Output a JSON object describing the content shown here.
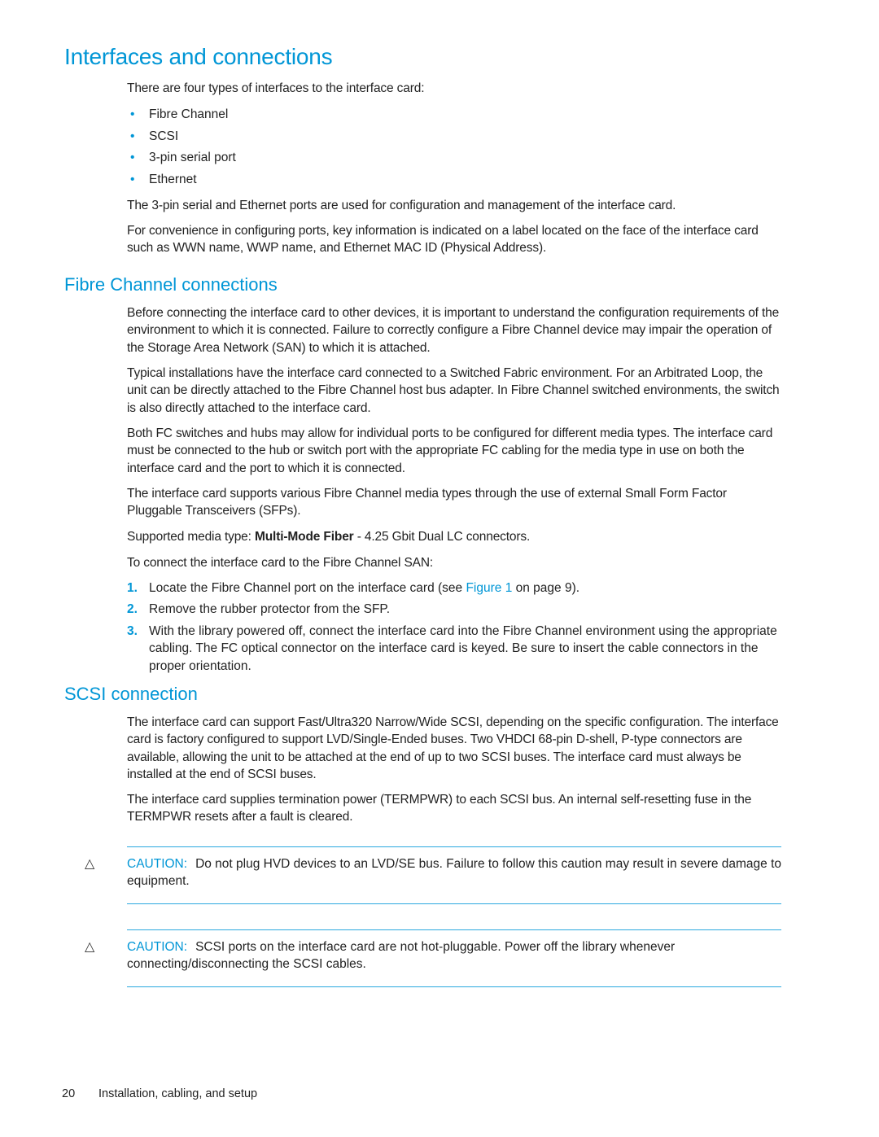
{
  "title": "Interfaces and connections",
  "intro": "There are four types of interfaces to the interface card:",
  "interface_types": [
    "Fibre Channel",
    "SCSI",
    "3-pin serial port",
    "Ethernet"
  ],
  "para_serial": "The 3-pin serial and Ethernet ports are used for configuration and management of the interface card.",
  "para_label": "For convenience in configuring ports, key information is indicated on a label located on the face of the interface card such as WWN name, WWP name, and Ethernet MAC ID (Physical Address).",
  "fc": {
    "heading": "Fibre Channel connections",
    "paragraphs": [
      "Before connecting the interface card to other devices, it is important to understand the configuration requirements of the environment to which it is connected. Failure to correctly configure a Fibre Channel device may impair the operation of the Storage Area Network (SAN) to which it is attached.",
      "Typical installations have the interface card connected to a Switched Fabric environment. For an Arbitrated Loop, the unit can be directly attached to the Fibre Channel host bus adapter. In Fibre Channel switched environments, the switch is also directly attached to the interface card.",
      "Both FC switches and hubs may allow for individual ports to be configured for different media types. The interface card must be connected to the hub or switch port with the appropriate FC cabling for the media type in use on both the interface card and the port to which it is connected.",
      "The interface card supports various Fibre Channel media types through the use of external Small Form Factor Pluggable Transceivers (SFPs)."
    ],
    "media_prefix": "Supported media type: ",
    "media_bold": "Multi-Mode Fiber",
    "media_suffix": " - 4.25 Gbit Dual LC connectors.",
    "steps_intro": "To connect the interface card to the Fibre Channel SAN:",
    "steps": [
      {
        "num": "1.",
        "pre": "Locate the Fibre Channel port on the interface card (see ",
        "link": "Figure 1",
        "post": " on page 9)."
      },
      {
        "num": "2.",
        "text": "Remove the rubber protector from the SFP."
      },
      {
        "num": "3.",
        "text": "With the library powered off, connect the interface card into the Fibre Channel environment using the appropriate cabling. The FC optical connector on the interface card is keyed. Be sure to insert the cable connectors in the proper orientation."
      }
    ]
  },
  "scsi": {
    "heading": "SCSI connection",
    "paragraphs": [
      "The interface card can support Fast/Ultra320 Narrow/Wide SCSI, depending on the specific configuration. The interface card is factory configured to support LVD/Single-Ended buses. Two VHDCI 68-pin D-shell, P-type connectors are available, allowing the unit to be attached at the end of up to two SCSI buses. The interface card must always be installed at the end of SCSI buses.",
      "The interface card supplies termination power (TERMPWR) to each SCSI bus. An internal self-resetting fuse in the TERMPWR resets after a fault is cleared."
    ]
  },
  "cautions": [
    {
      "icon": "△",
      "label": "CAUTION:",
      "text": "Do not plug HVD devices to an LVD/SE bus. Failure to follow this caution may result in severe damage to equipment."
    },
    {
      "icon": "△",
      "label": "CAUTION:",
      "text": "SCSI ports on the interface card are not hot-pluggable. Power off the library whenever connecting/disconnecting the SCSI cables."
    }
  ],
  "footer": {
    "page": "20",
    "section": "Installation, cabling, and setup"
  }
}
